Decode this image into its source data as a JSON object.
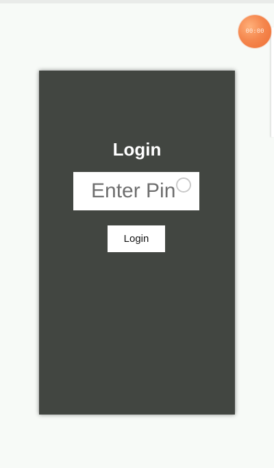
{
  "status": {
    "timer_text": "00:00"
  },
  "login": {
    "title": "Login",
    "pin_placeholder": "Enter Pin",
    "button_label": "Login"
  },
  "colors": {
    "page_background": "#f7faf7",
    "panel_background": "#424641",
    "timer_bubble": "#f5884f"
  },
  "icons": {
    "timer": "timer-bubble-icon",
    "touch": "touch-indicator-icon"
  }
}
